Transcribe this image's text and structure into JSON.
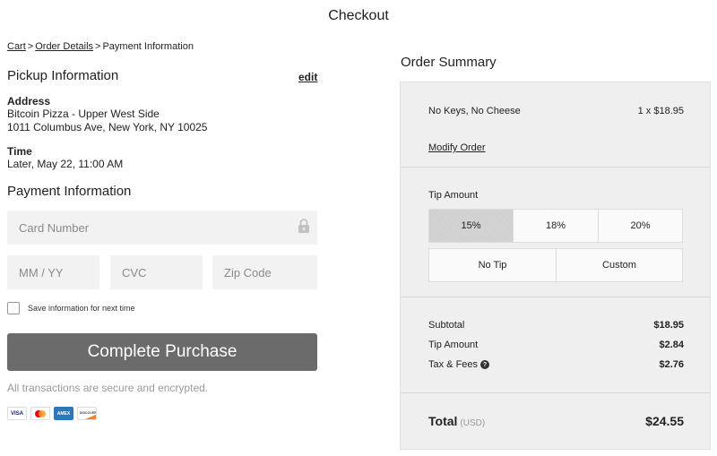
{
  "header": {
    "title": "Checkout"
  },
  "breadcrumb": {
    "cart": "Cart",
    "order_details": "Order Details",
    "current": "Payment Information",
    "separator": ">"
  },
  "pickup": {
    "heading": "Pickup Information",
    "edit_label": "edit",
    "address_label": "Address",
    "address_line1": "Bitcoin Pizza - Upper West Side",
    "address_line2": "1011 Columbus Ave, New York, NY 10025",
    "time_label": "Time",
    "time_value": "Later, May 22, 11:00 AM"
  },
  "payment": {
    "heading": "Payment Information",
    "card_placeholder": "Card Number",
    "expiry_placeholder": "MM / YY",
    "cvc_placeholder": "CVC",
    "zip_placeholder": "Zip Code",
    "save_label": "Save information for next time",
    "purchase_button": "Complete Purchase",
    "secure_text": "All transactions are secure and encrypted.",
    "card_logos": [
      "visa-logo",
      "mastercard-logo",
      "amex-logo",
      "discover-logo"
    ]
  },
  "summary": {
    "heading": "Order Summary",
    "item_name": "No Keys, No Cheese",
    "item_price": "1 x $18.95",
    "modify_link": "Modify Order",
    "tip_label": "Tip Amount",
    "tip_options": [
      "15%",
      "18%",
      "20%",
      "No Tip",
      "Custom"
    ],
    "tip_selected": "15%",
    "subtotal_label": "Subtotal",
    "subtotal_value": "$18.95",
    "tip_amount_label": "Tip Amount",
    "tip_amount_value": "$2.84",
    "tax_label": "Tax & Fees",
    "tax_value": "$2.76",
    "total_label": "Total",
    "total_currency": "(USD)",
    "total_value": "$24.55"
  },
  "colors": {
    "button_bg": "#6b6b6b",
    "summary_bg": "#efefef",
    "field_bg": "#f2f2f2"
  }
}
